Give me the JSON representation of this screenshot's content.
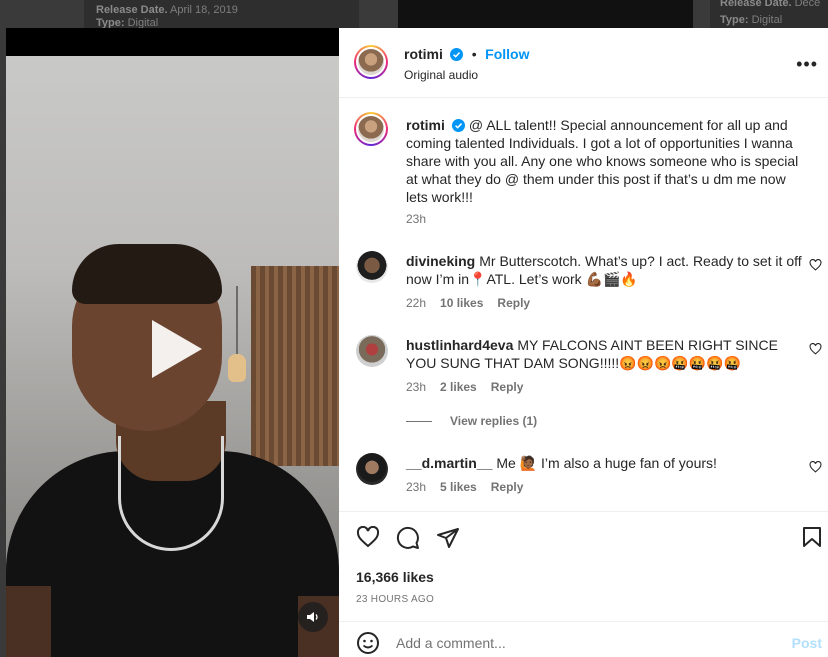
{
  "background": {
    "card1_release": "Release Date.",
    "card1_date": "April 18, 2019",
    "card1_type_label": "Type:",
    "card1_type_value": "Digital",
    "card3_release": "Release Date.",
    "card3_date": "Dece",
    "card3_type_label": "Type:",
    "card3_type_value": "Digital"
  },
  "header": {
    "username": "rotimi",
    "separator": "•",
    "follow_label": "Follow",
    "subtitle": "Original audio",
    "more_icon": "more-horizontal-icon"
  },
  "caption": {
    "username": "rotimi",
    "text": "@ ALL talent!! Special announcement for all up and coming talented Individuals. I got a lot of opportunities I wanna share with you all. Any one who knows someone who is special at what they do @ them under this post if that’s u dm me now lets work!!!",
    "time": "23h"
  },
  "comments": [
    {
      "username": "divineking",
      "text": "Mr Butterscotch. What’s up? I act. Ready to set it off now I’m in📍ATL. Let’s work 💪🏾🎬🔥",
      "time": "22h",
      "likes": "10 likes",
      "reply": "Reply"
    },
    {
      "username": "hustlinhard4eva",
      "text": "MY FALCONS AINT BEEN RIGHT SINCE YOU SUNG THAT DAM SONG!!!!!😡😡😡🤬🤬🤬🤬",
      "time": "23h",
      "likes": "2 likes",
      "reply": "Reply",
      "view_replies": "View replies (1)"
    },
    {
      "username": "__d.martin__",
      "text": "Me 🙋🏾 I’m also a huge fan of yours!",
      "time": "23h",
      "likes": "5 likes",
      "reply": "Reply"
    }
  ],
  "actions": {
    "likes": "16,366 likes",
    "posted": "23 HOURS AGO",
    "add_comment_placeholder": "Add a comment...",
    "post_label": "Post"
  },
  "colors": {
    "accent": "#0095f6",
    "post_disabled": "#b2dffc",
    "muted": "#737373"
  }
}
